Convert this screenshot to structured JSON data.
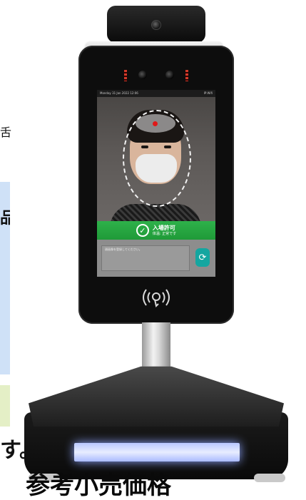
{
  "page_fragments": {
    "left_char_top": "舌",
    "left_char_mid": "品",
    "left_char_bottom": "す。",
    "bottom_heading": "参考小売価格"
  },
  "device": {
    "status_bar": {
      "left": "Monday 31 Jan 2022 12:06",
      "right": "IP:Wifi"
    },
    "result_banner": {
      "main": "入場許可",
      "sub": "体温: 正常です"
    },
    "info_text": "顔画像を登録してください。"
  },
  "icons": {
    "check": "check-circle-icon",
    "sync": "sync-icon",
    "nfc": "nfc-reader-icon"
  },
  "colors": {
    "banner_green": "#22a23f",
    "sync_teal": "#14a6a0",
    "temp_dot_red": "#e01818",
    "light_strip": "#c9d4ff"
  }
}
